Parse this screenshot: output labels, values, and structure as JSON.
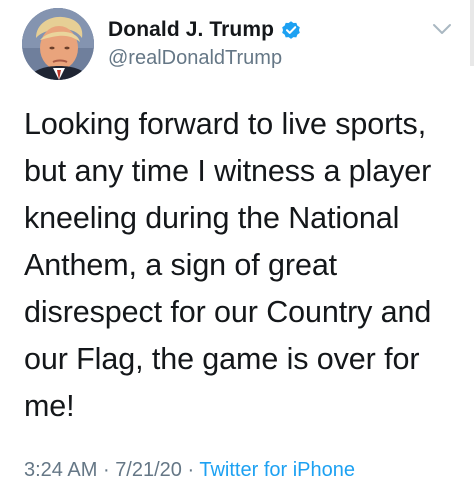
{
  "tweet": {
    "author": {
      "display_name": "Donald J. Trump",
      "handle": "@realDonaldTrump",
      "verified": true,
      "avatar_icon": "profile-photo"
    },
    "text": "Looking forward to live sports,\nbut any time I witness a player\nkneeling during the National\nAnthem, a sign of great\ndisrespect for our Country and\nour Flag, the game is over for\nme!",
    "time": "3:24 AM",
    "separator": "·",
    "date": "7/21/20",
    "source": "Twitter for iPhone",
    "menu_icon": "chevron-down-icon"
  },
  "colors": {
    "text_primary": "#14171a",
    "text_secondary": "#657786",
    "accent": "#1da1f2",
    "background": "#ffffff"
  }
}
